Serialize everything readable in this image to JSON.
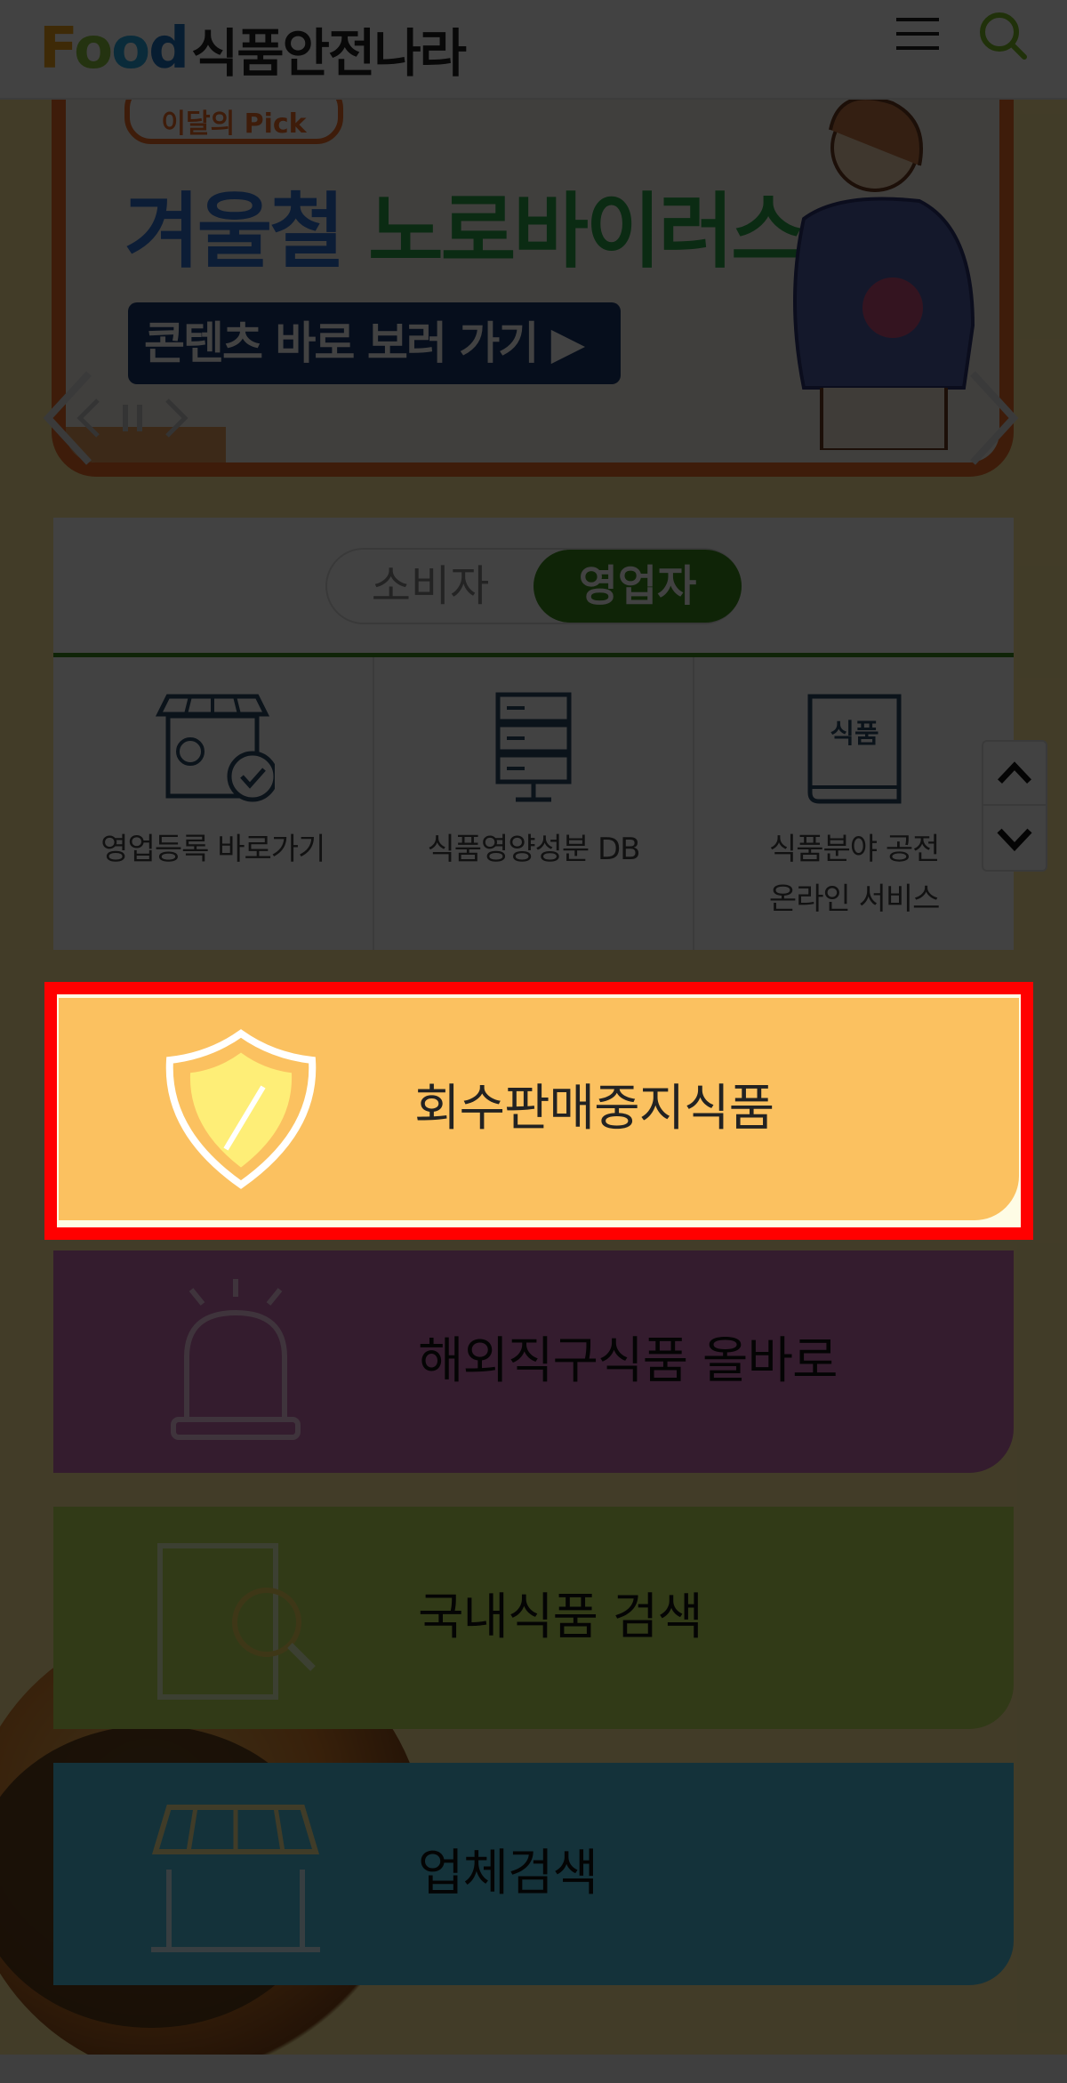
{
  "header": {
    "logo_food": "Food",
    "logo_name": "식품안전나라",
    "menu_icon": "hamburger-menu-icon",
    "search_icon": "search-icon"
  },
  "banner": {
    "badge": "이달의 Pick",
    "title_part1": "겨울철",
    "title_part2": "노로바이러스",
    "cta": "콘텐츠 바로 보러 가기 ▶",
    "colors": {
      "frame": "#ee6e2a",
      "title1": "#2f6fcf",
      "title2": "#2ba84a",
      "cta": "#19376b"
    }
  },
  "tabs": {
    "consumer": "소비자",
    "business": "영업자",
    "active": "영업자",
    "accent": "#3a8c1c"
  },
  "quick_links": [
    {
      "label": "영업등록 바로가기",
      "icon": "storefront-check-icon"
    },
    {
      "label": "식품영양성분 DB",
      "icon": "database-server-icon"
    },
    {
      "label_line1": "식품분야 공전",
      "label_line2": "온라인 서비스",
      "icon": "food-book-icon",
      "book_text": "식품"
    }
  ],
  "services": {
    "recall": {
      "label": "회수판매중지식품",
      "icon": "shield-icon",
      "color": "#fbc160"
    },
    "overseas": {
      "label": "해외직구식품 올바로",
      "icon": "siren-icon",
      "color": "#c96bb0"
    },
    "domestic": {
      "label": "국내식품 검색",
      "icon": "document-search-icon",
      "color": "#bde05a"
    },
    "company": {
      "label": "업체검색",
      "icon": "store-icon",
      "color": "#4fc0df"
    }
  },
  "highlight_color": "#ff0000"
}
